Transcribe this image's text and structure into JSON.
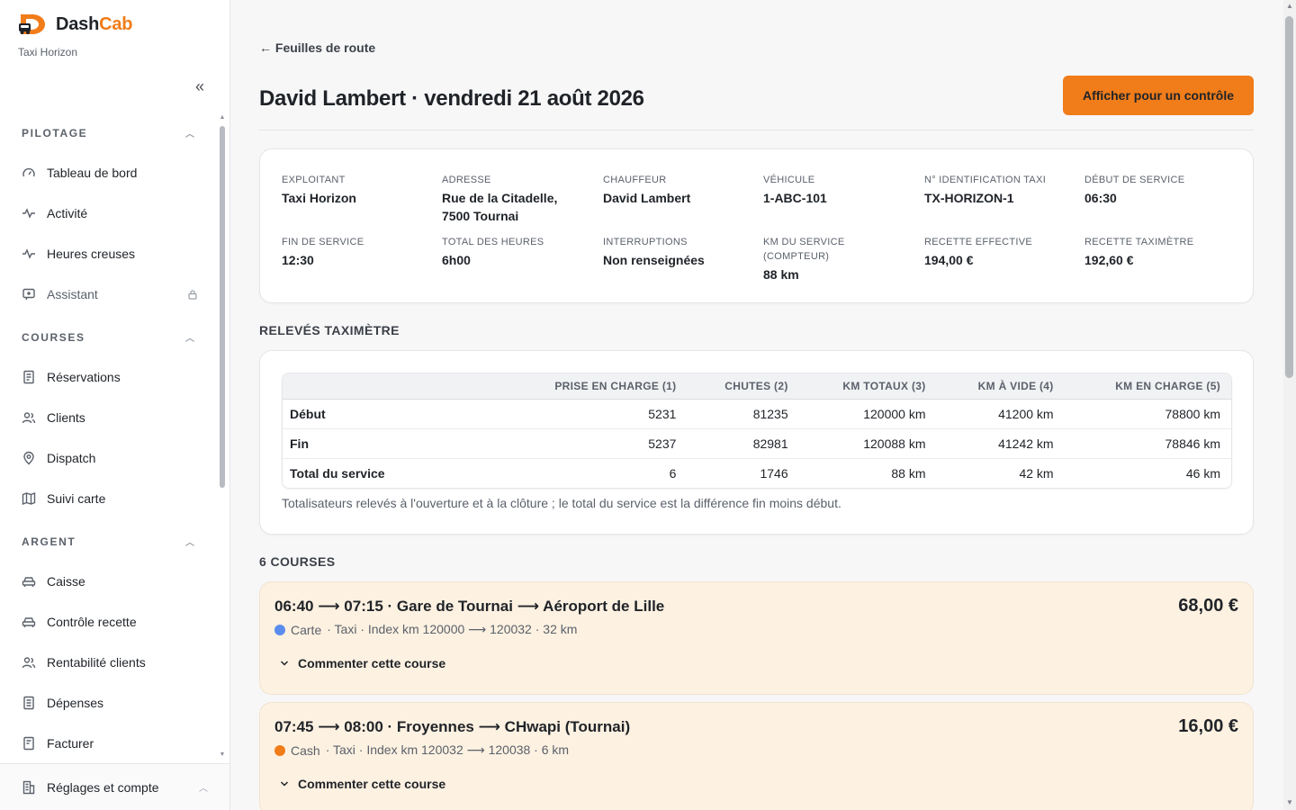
{
  "brand": {
    "name_prefix": "Dash",
    "name_suffix": "Cab",
    "org": "Taxi Horizon",
    "accent": "#f07c1a"
  },
  "sidebar": {
    "sections": [
      {
        "title": "PILOTAGE",
        "items": [
          {
            "label": "Tableau de bord",
            "icon": "gauge-icon"
          },
          {
            "label": "Activité",
            "icon": "activity-icon"
          },
          {
            "label": "Heures creuses",
            "icon": "activity-icon"
          },
          {
            "label": "Assistant",
            "icon": "chat-icon",
            "locked": true
          }
        ]
      },
      {
        "title": "COURSES",
        "items": [
          {
            "label": "Réservations",
            "icon": "document-icon"
          },
          {
            "label": "Clients",
            "icon": "users-icon"
          },
          {
            "label": "Dispatch",
            "icon": "location-icon"
          },
          {
            "label": "Suivi carte",
            "icon": "map-icon"
          }
        ]
      },
      {
        "title": "ARGENT",
        "items": [
          {
            "label": "Caisse",
            "icon": "car-icon"
          },
          {
            "label": "Contrôle recette",
            "icon": "car-icon"
          },
          {
            "label": "Rentabilité clients",
            "icon": "users-icon"
          },
          {
            "label": "Dépenses",
            "icon": "receipt-icon"
          },
          {
            "label": "Facturer",
            "icon": "invoice-icon"
          }
        ]
      }
    ],
    "footer_label": "Réglages et compte"
  },
  "header": {
    "back_label": "← Feuilles de route",
    "title": "David Lambert · vendredi 21 août 2026",
    "control_button": "Afficher pour un contrôle"
  },
  "info": [
    {
      "label": "EXPLOITANT",
      "value": "Taxi Horizon"
    },
    {
      "label": "ADRESSE",
      "value": "Rue de la Citadelle,",
      "value2": "7500 Tournai"
    },
    {
      "label": "CHAUFFEUR",
      "value": "David Lambert"
    },
    {
      "label": "VÉHICULE",
      "value": "1-ABC-101"
    },
    {
      "label": "N° IDENTIFICATION TAXI",
      "value": "TX-HORIZON-1"
    },
    {
      "label": "DÉBUT DE SERVICE",
      "value": "06:30"
    },
    {
      "label": "FIN DE SERVICE",
      "value": "12:30"
    },
    {
      "label": "TOTAL DES HEURES",
      "value": "6h00"
    },
    {
      "label": "INTERRUPTIONS",
      "value": "Non renseignées"
    },
    {
      "label": "KM DU SERVICE",
      "label2": "(COMPTEUR)",
      "value": "88 km"
    },
    {
      "label": "RECETTE EFFECTIVE",
      "value": "194,00 €"
    },
    {
      "label": "RECETTE TAXIMÈTRE",
      "value": "192,60 €"
    }
  ],
  "meter": {
    "section_title": "RELEVÉS TAXIMÈTRE",
    "columns": [
      "",
      "PRISE EN CHARGE (1)",
      "CHUTES (2)",
      "KM TOTAUX (3)",
      "KM À VIDE (4)",
      "KM EN CHARGE (5)"
    ],
    "rows": [
      [
        "Début",
        "5231",
        "81235",
        "120000 km",
        "41200 km",
        "78800 km"
      ],
      [
        "Fin",
        "5237",
        "82981",
        "120088 km",
        "41242 km",
        "78846 km"
      ],
      [
        "Total du service",
        "6",
        "1746",
        "88 km",
        "42 km",
        "46 km"
      ]
    ],
    "note": "Totalisateurs relevés à l'ouverture et à la clôture ; le total du service est la différence fin moins début."
  },
  "rides": {
    "section_title": "6 COURSES",
    "comment_label": "Commenter cette course",
    "items": [
      {
        "title": "06:40 ⟶ 07:15 · Gare de Tournai ⟶ Aéroport de Lille",
        "price": "68,00 €",
        "payment": "Carte",
        "meta": "· Taxi · Index km 120000 ⟶ 120032 · 32 km",
        "dot_color": "#5b8def"
      },
      {
        "title": "07:45 ⟶ 08:00 · Froyennes ⟶ CHwapi (Tournai)",
        "price": "16,00 €",
        "payment": "Cash",
        "meta": "· Taxi · Index km 120032 ⟶ 120038 · 6 km",
        "dot_color": "#f07c1a"
      }
    ]
  }
}
